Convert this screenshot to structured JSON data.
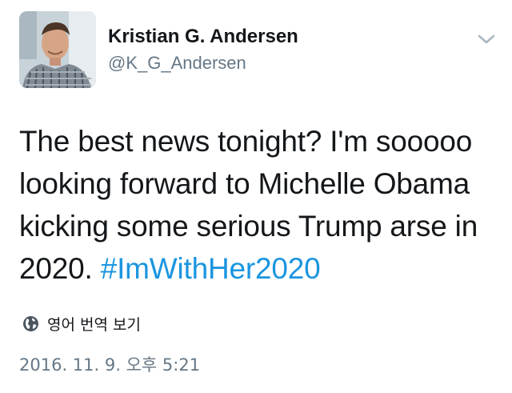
{
  "tweet": {
    "author": {
      "display_name": "Kristian G. Andersen",
      "handle": "@K_G_Andersen",
      "avatar_icon": "profile-photo"
    },
    "menu_icon": "chevron-down-icon",
    "text": "The best news tonight? I'm sooooo looking forward to Michelle Obama kicking some serious Trump arse in 2020.",
    "hashtag": "#ImWithHer2020",
    "translate": {
      "icon": "globe-icon",
      "label": "영어 번역 보기"
    },
    "timestamp": "2016. 11. 9. 오후 5:21"
  },
  "colors": {
    "text_primary": "#14171a",
    "text_secondary": "#657786",
    "link": "#1b95e0",
    "background": "#ffffff"
  }
}
